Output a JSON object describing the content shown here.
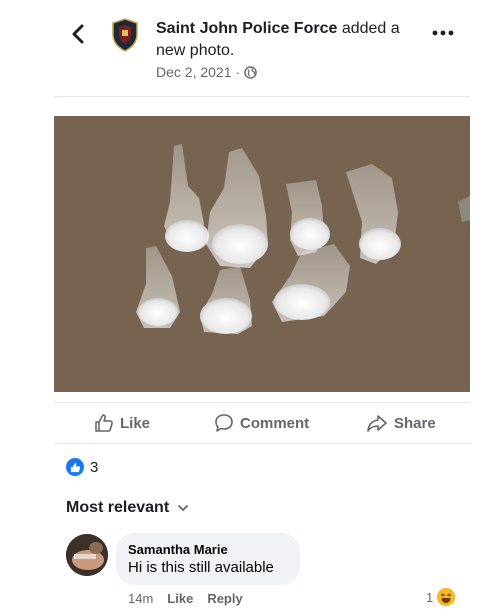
{
  "post": {
    "page_name": "Saint John Police Force",
    "action_text": " added a new photo.",
    "date": "Dec 2, 2021",
    "separator": "·",
    "privacy_icon": "globe-icon",
    "more_icon": "ellipsis-icon"
  },
  "actions": {
    "like_label": "Like",
    "comment_label": "Comment",
    "share_label": "Share"
  },
  "reactions": {
    "count": "3",
    "icon": "like-reaction-icon"
  },
  "comments": {
    "sort_label": "Most relevant",
    "items": [
      {
        "author": "Samantha Marie",
        "text": "Hi is this still available",
        "time": "14m",
        "like_label": "Like",
        "reply_label": "Reply",
        "reaction_count": "1",
        "reaction_icon": "haha-reaction-icon"
      }
    ]
  },
  "colors": {
    "brand_blue": "#1877f2",
    "secondary_text": "#65676b",
    "bubble_bg": "#f0f2f5"
  }
}
